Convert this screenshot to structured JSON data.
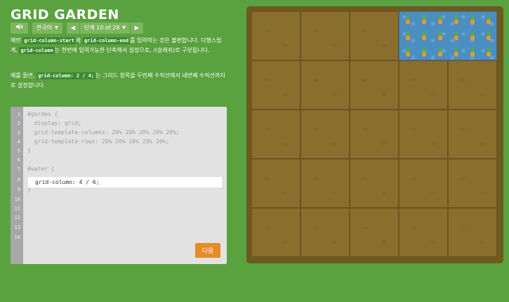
{
  "app": {
    "title": "GRID GARDEN"
  },
  "toolbar": {
    "language": "한국어",
    "level": "단계 10 of 28",
    "prev": "◀",
    "next": "▶",
    "sound": "◀))"
  },
  "instructions": {
    "p1_a": "매번 ",
    "p1_code1": "grid-column-start",
    "p1_b": "와 ",
    "p1_code2": "grid-column-end",
    "p1_c": "를 입력하는 것은 불편합니다. 다행스럽게, ",
    "p1_code3": "grid-column",
    "p1_d": "는 한번에 입력가능한 단축해서 설정으로, /(슬래쉬)로 구분됩니다.",
    "p2_a": "예를 들면, ",
    "p2_code": "grid-column: 2 / 4;",
    "p2_b": "는 그리드 항목을 두번째 수직선에서 네번째 수직선까지로 설정합니다."
  },
  "editor": {
    "line_numbers": [
      "1",
      "2",
      "3",
      "4",
      "5",
      "6",
      "7",
      "8",
      "9",
      "10",
      "11",
      "12",
      "13",
      "14"
    ],
    "lines": [
      "#garden {",
      "  display: grid;",
      "  grid-template-columns: 20% 20% 20% 20% 20%;",
      "  grid-template-rows: 20% 20% 20% 20% 20%;",
      "}",
      "",
      "#water {",
      "",
      "}"
    ],
    "input_value": "grid-column: 4 / 6;",
    "next_button": "다음"
  },
  "colors": {
    "background": "#5aa13f",
    "water": "#4a8ec2",
    "soil": "#8b6d2e",
    "next_button": "#e58b28"
  }
}
